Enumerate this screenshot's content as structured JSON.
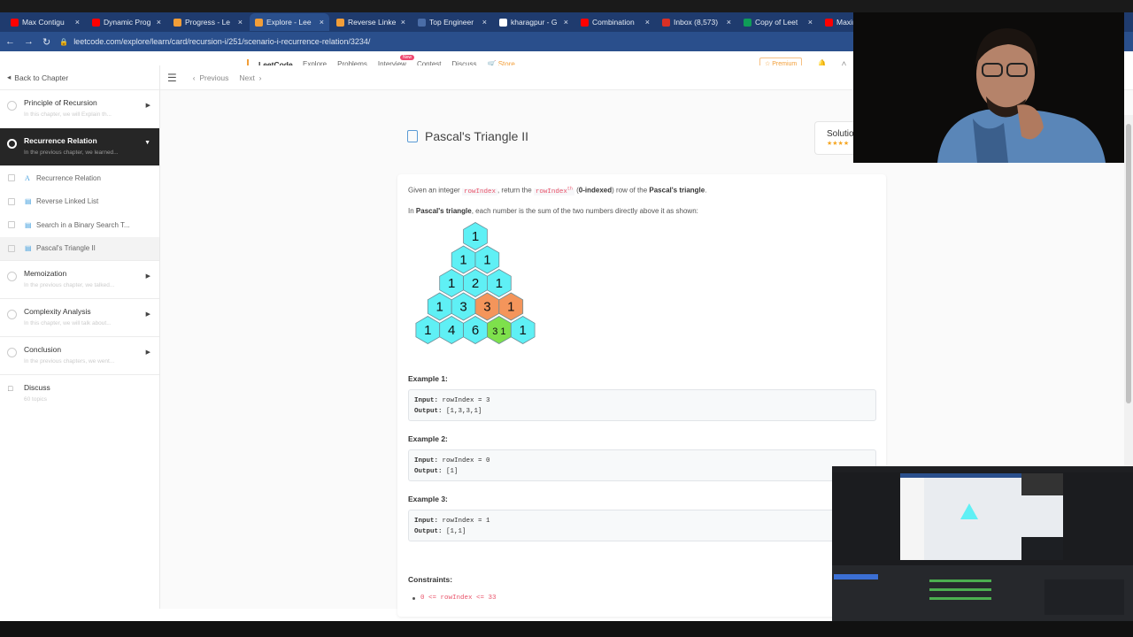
{
  "browser": {
    "tabs": [
      {
        "title": "Max Contigu",
        "color": "#ff0000",
        "active": false
      },
      {
        "title": "Dynamic Prog",
        "color": "#ff0000",
        "active": false
      },
      {
        "title": "Progress - Le",
        "color": "#f29e38",
        "active": false
      },
      {
        "title": "Explore - Lee",
        "color": "#f29e38",
        "active": true
      },
      {
        "title": "Reverse Linke",
        "color": "#f29e38",
        "active": false
      },
      {
        "title": "Top Engineer",
        "color": "#4a6da7",
        "active": false
      },
      {
        "title": "kharagpur - G",
        "color": "#ffffff",
        "active": false
      },
      {
        "title": "Combination",
        "color": "#ff0000",
        "active": false
      },
      {
        "title": "Inbox (8,573)",
        "color": "#d93025",
        "active": false
      },
      {
        "title": "Copy of Leet",
        "color": "#0f9d58",
        "active": false
      },
      {
        "title": "Maxin",
        "color": "#ff0000",
        "active": false
      }
    ],
    "url": "leetcode.com/explore/learn/card/recursion-i/251/scenario-i-recurrence-relation/3234/"
  },
  "header": {
    "logo": "LeetCode",
    "nav": [
      "Explore",
      "Problems",
      "Interview",
      "Contest",
      "Discuss",
      "Store"
    ],
    "new_badge": "New",
    "premium": "Premium"
  },
  "sidebar": {
    "back": "Back to Chapter",
    "chapters_top": [
      {
        "title": "Principle of Recursion",
        "sub": "In this chapter, we will Explain th..."
      }
    ],
    "active_chapter": {
      "title": "Recurrence Relation",
      "sub": "In the previous chapter, we learned..."
    },
    "items": [
      {
        "label": "Recurrence Relation",
        "icon": "A"
      },
      {
        "label": "Reverse Linked List",
        "icon": "doc"
      },
      {
        "label": "Search in a Binary Search T...",
        "icon": "doc"
      },
      {
        "label": "Pascal's Triangle II",
        "icon": "doc"
      }
    ],
    "chapters_bottom": [
      {
        "title": "Memoization",
        "sub": "In the previous chapter, we talked..."
      },
      {
        "title": "Complexity Analysis",
        "sub": "In this chapter, we will talk about..."
      },
      {
        "title": "Conclusion",
        "sub": "In the previous chapters, we went..."
      }
    ],
    "discuss": {
      "title": "Discuss",
      "sub": "60 topics"
    }
  },
  "subbar": {
    "previous": "Previous",
    "next": "Next"
  },
  "problem": {
    "title": "Pascal's Triangle II",
    "solution_label": "Solutio",
    "intro_pre": "Given an integer ",
    "intro_code1": "rowIndex",
    "intro_mid": ", return the ",
    "intro_code2": "rowIndex",
    "intro_sup": "th",
    "intro_b1": "0-indexed",
    "intro_mid2": ") row of the ",
    "intro_b2": "Pascal's triangle",
    "intro_end": ".",
    "line2_pre": "In ",
    "line2_b": "Pascal's triangle",
    "line2_rest": ", each number is the sum of the two numbers directly above it as shown:",
    "triangle_rows": [
      [
        "1"
      ],
      [
        "1",
        "1"
      ],
      [
        "1",
        "2",
        "1"
      ],
      [
        "1",
        "3",
        "3",
        "1"
      ],
      [
        "1",
        "4",
        "6",
        "3 1",
        "1"
      ]
    ],
    "examples": [
      {
        "label": "Example 1:",
        "input_k": "Input:",
        "input_v": " rowIndex = 3",
        "output_k": "Output:",
        "output_v": " [1,3,3,1]"
      },
      {
        "label": "Example 2:",
        "input_k": "Input:",
        "input_v": " rowIndex = 0",
        "output_k": "Output:",
        "output_v": " [1]"
      },
      {
        "label": "Example 3:",
        "input_k": "Input:",
        "input_v": " rowIndex = 1",
        "output_k": "Output:",
        "output_v": " [1,1]"
      }
    ],
    "constraints_label": "Constraints:",
    "constraint": "0 <= rowIndex <= 33"
  },
  "colors": {
    "hex_cyan": "#5ff0f5",
    "hex_orange": "#f4955b",
    "hex_green": "#7ee04c",
    "accent": "#f29e38"
  }
}
